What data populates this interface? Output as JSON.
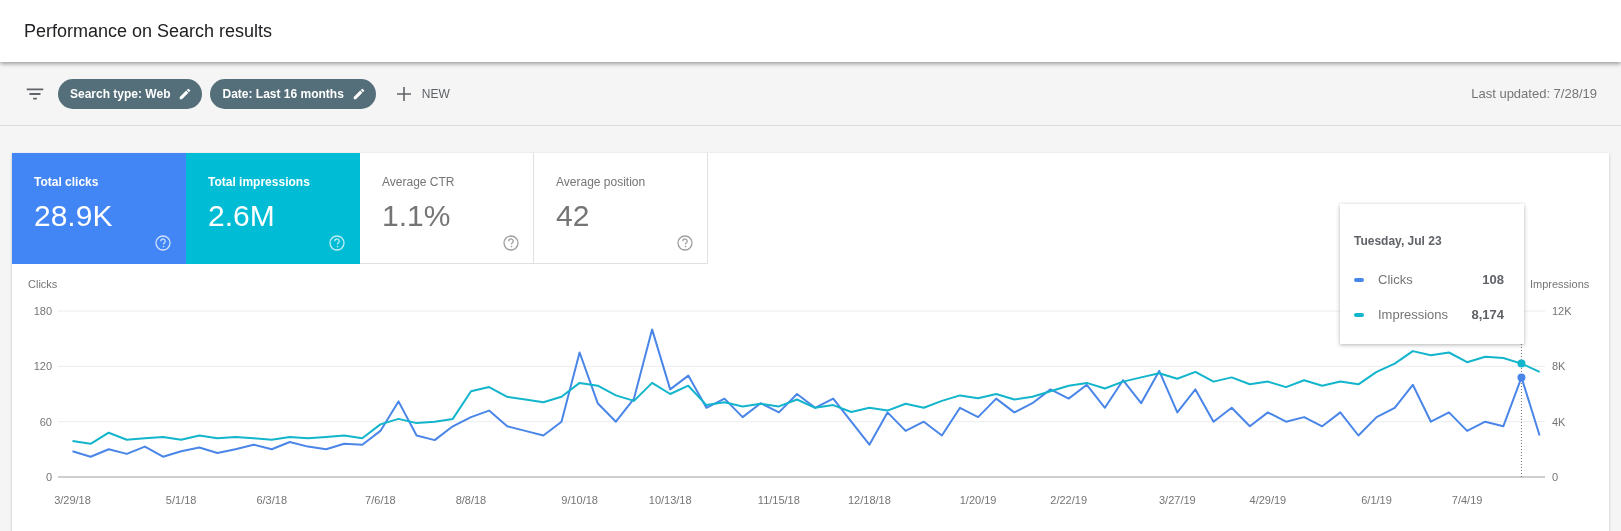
{
  "header": {
    "title": "Performance on Search results"
  },
  "toolbar": {
    "filters": [
      {
        "label": "Search type: Web"
      },
      {
        "label": "Date: Last 16 months"
      }
    ],
    "new_button": "NEW",
    "last_updated": "Last updated: 7/28/19"
  },
  "metrics": [
    {
      "label": "Total clicks",
      "value": "28.9K",
      "selected": true,
      "color": "#4285f4"
    },
    {
      "label": "Total impressions",
      "value": "2.6M",
      "selected": true,
      "color": "#00bcd4"
    },
    {
      "label": "Average CTR",
      "value": "1.1%",
      "selected": false
    },
    {
      "label": "Average position",
      "value": "42",
      "selected": false
    }
  ],
  "chart": {
    "chart_data": {
      "type": "line",
      "ylabel": "Clicks",
      "y2label": "Impressions",
      "ylim": [
        0,
        180
      ],
      "y2lim": [
        0,
        12000
      ],
      "yticks": [
        0,
        60,
        120,
        180
      ],
      "y2ticks": [
        {
          "value": 0,
          "label": "0"
        },
        {
          "value": 4000,
          "label": "4K"
        },
        {
          "value": 8000,
          "label": "8K"
        },
        {
          "value": 12000,
          "label": "12K"
        }
      ],
      "categories": [
        "3/29/18",
        null,
        null,
        null,
        null,
        null,
        "5/1/18",
        null,
        null,
        null,
        null,
        "6/3/18",
        null,
        null,
        null,
        null,
        null,
        "7/6/18",
        null,
        null,
        null,
        null,
        "8/8/18",
        null,
        null,
        null,
        null,
        null,
        "9/10/18",
        null,
        null,
        null,
        null,
        "10/13/18",
        null,
        null,
        null,
        null,
        null,
        "11/15/18",
        null,
        null,
        null,
        null,
        "12/18/18",
        null,
        null,
        null,
        null,
        null,
        "1/20/19",
        null,
        null,
        null,
        null,
        "2/22/19",
        null,
        null,
        null,
        null,
        null,
        "3/27/19",
        null,
        null,
        null,
        null,
        "4/29/19",
        null,
        null,
        null,
        null,
        null,
        "6/1/19",
        null,
        null,
        null,
        null,
        "7/4/19",
        null,
        null,
        null,
        null
      ],
      "series": [
        {
          "color": "#4a86e8",
          "values": [
            28,
            22,
            30,
            25,
            33,
            22,
            28,
            32,
            26,
            30,
            35,
            30,
            38,
            33,
            30,
            36,
            35,
            50,
            82,
            45,
            40,
            55,
            65,
            72,
            55,
            50,
            45,
            60,
            135,
            80,
            60,
            85,
            160,
            95,
            110,
            75,
            85,
            65,
            80,
            70,
            90,
            75,
            85,
            60,
            35,
            70,
            50,
            60,
            45,
            75,
            65,
            85,
            70,
            80,
            95,
            85,
            100,
            75,
            105,
            80,
            115,
            70,
            95,
            60,
            75,
            55,
            70,
            60,
            65,
            55,
            70,
            45,
            65,
            75,
            100,
            60,
            70,
            50,
            60,
            55,
            108,
            45
          ]
        },
        {
          "color": "#12b5cb",
          "axis": "y2",
          "values": [
            2600,
            2400,
            3200,
            2700,
            2800,
            2900,
            2700,
            3000,
            2800,
            2900,
            2800,
            2700,
            2900,
            2800,
            2900,
            3000,
            2800,
            3800,
            4200,
            3900,
            4000,
            4200,
            6200,
            6500,
            5800,
            5600,
            5400,
            5800,
            6800,
            6600,
            5900,
            5500,
            6800,
            6000,
            6600,
            5200,
            5400,
            5100,
            5300,
            5100,
            5600,
            5000,
            5200,
            4700,
            5000,
            4800,
            5300,
            5000,
            5500,
            5900,
            5700,
            6000,
            5600,
            5800,
            6200,
            6600,
            6800,
            6400,
            6900,
            7200,
            7500,
            7100,
            7600,
            6900,
            7200,
            6700,
            6900,
            6500,
            7000,
            6600,
            6900,
            6700,
            7600,
            8200,
            9100,
            8800,
            9000,
            8300,
            8700,
            8600,
            8200,
            7600
          ]
        }
      ]
    },
    "tooltip": {
      "title": "Tuesday, Jul 23",
      "rows": [
        {
          "label": "Clicks",
          "value": "108"
        },
        {
          "label": "Impressions",
          "value": "8,174"
        }
      ]
    }
  }
}
